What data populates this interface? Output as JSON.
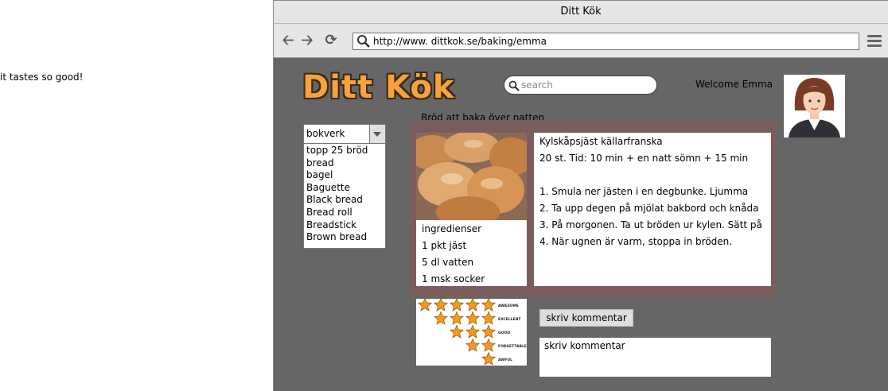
{
  "side_note": "it tastes so good!",
  "window": {
    "title": "Ditt Kök"
  },
  "toolbar": {
    "url": "http://www. dittkok.se/baking/emma"
  },
  "site": {
    "logo": "Ditt Kök",
    "search_placeholder": "search",
    "welcome": "Welcome Emma"
  },
  "category_dropdown": {
    "selected": "bokverk",
    "options": [
      "topp 25 bröd",
      "bread",
      "bagel",
      "Baguette",
      "Black bread",
      "Bread roll",
      "Breadstick",
      "Brown bread"
    ]
  },
  "section": {
    "heading": "Bröd att baka över natten"
  },
  "ingredients": [
    "ingredienser",
    "1 pkt jäst",
    "5 dl vatten",
    "1 msk socker"
  ],
  "recipe": {
    "title": "Kylskåpsjäst källarfranska",
    "meta": "20 st. Tid: 10 min + en natt sömn + 15 min",
    "steps": [
      "1.  Smula ner jästen i en degbunke. Ljumma",
      "2. Ta upp degen på mjölat bakbord och knåda",
      "3. På morgonen. Ta ut bröden ur kylen. Sätt på",
      "4. När ugnen är varm, stoppa in bröden."
    ]
  },
  "rating_scale": [
    {
      "stars": 5,
      "label": "AWESOME"
    },
    {
      "stars": 4,
      "label": "EXCELLENT"
    },
    {
      "stars": 3,
      "label": "GOOD"
    },
    {
      "stars": 2,
      "label": "FORGETTABLE"
    },
    {
      "stars": 1,
      "label": "AWFUL"
    }
  ],
  "comments": {
    "button_label": "skriv kommentar",
    "box_text": "skriv kommentar"
  }
}
